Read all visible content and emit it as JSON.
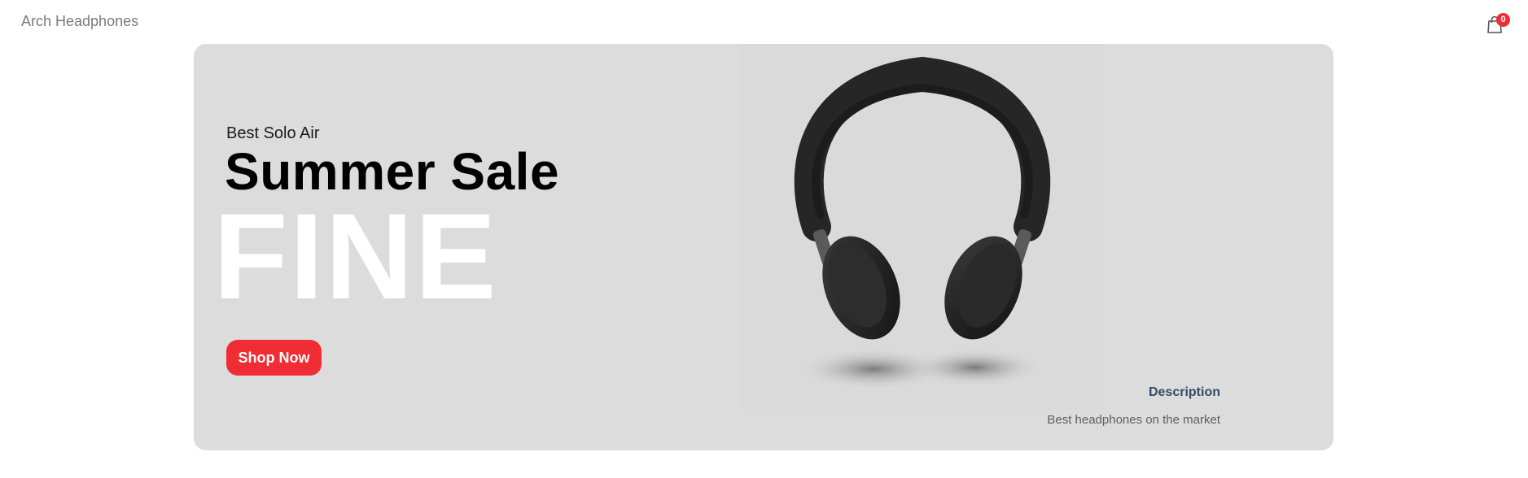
{
  "navbar": {
    "logo": "Arch Headphones",
    "cart_count": "0"
  },
  "hero": {
    "small_text": "Best Solo Air",
    "mid_text": "Summer Sale",
    "large_text": "FINE",
    "button_label": "Shop Now",
    "product_image": "headphones-image",
    "description": {
      "title": "Description",
      "text": "Best headphones on the market"
    }
  },
  "colors": {
    "accent": "#f02d34",
    "banner_bg": "#dcdcdc",
    "description_title": "#324d67"
  }
}
